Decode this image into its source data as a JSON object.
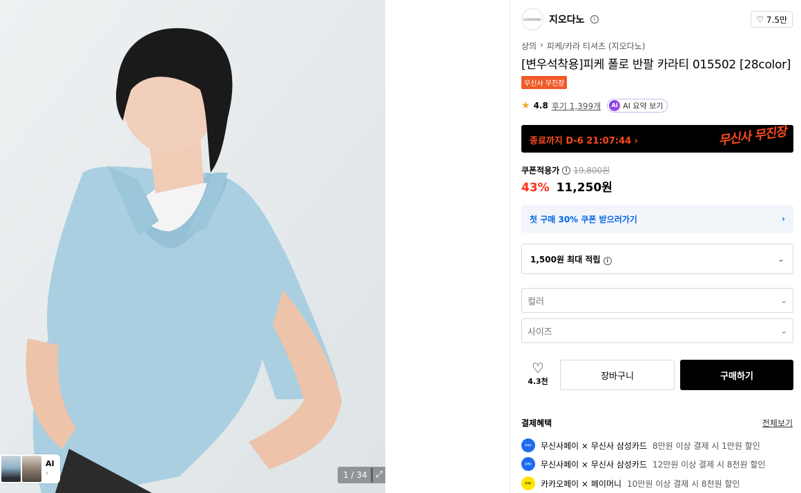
{
  "gallery": {
    "counter": "1 / 34",
    "thumbs_label": "AI"
  },
  "brand": {
    "name": "지오다노",
    "logo_text": "GIORDANO",
    "likes": "7.5만"
  },
  "breadcrumb": [
    "상의",
    "피케/카라 티셔츠 (지오다노)"
  ],
  "product": {
    "title": "[변우석착용]피케 폴로 반팔 카라티 015502 [28color]",
    "badge": "무신사 무진장",
    "rating": "4.8",
    "reviews": "후기 1,399개",
    "ai_summary": "AI 요약 보기"
  },
  "timer": {
    "text": "종료까지 D-6 21:07:44 ›",
    "logo": "무신사 무진장"
  },
  "price": {
    "coupon_label": "쿠폰적용가",
    "original": "19,800원",
    "discount": "43%",
    "final": "11,250원"
  },
  "first_coupon": "첫 구매 30% 쿠폰 받으러가기",
  "points": "1,500원 최대 적립",
  "options": {
    "color_placeholder": "컬러",
    "size_placeholder": "사이즈"
  },
  "actions": {
    "wish_count": "4.3천",
    "cart": "장바구니",
    "buy": "구매하기"
  },
  "benefits": {
    "title": "결제혜택",
    "more": "전체보기",
    "items": [
      {
        "icon": "musinsa-pay-icon",
        "main": "무신사페이 × 무신사 삼성카드",
        "sub": "8만원 이상 결제 시 1만원 할인"
      },
      {
        "icon": "musinsa-pay-icon",
        "main": "무신사페이 × 무신사 삼성카드",
        "sub": "12만원 이상 결제 시 8천원 할인"
      },
      {
        "icon": "kakaopay-icon",
        "main": "카카오페이 × 페이머니",
        "sub": "10만원 이상 결제 시 8천원 할인"
      }
    ]
  },
  "colors": {
    "accent_red": "#ff2f14",
    "badge_orange": "#f05a28",
    "coupon_blue": "#0064e6",
    "shirt_blue": "#a9cfe1"
  }
}
